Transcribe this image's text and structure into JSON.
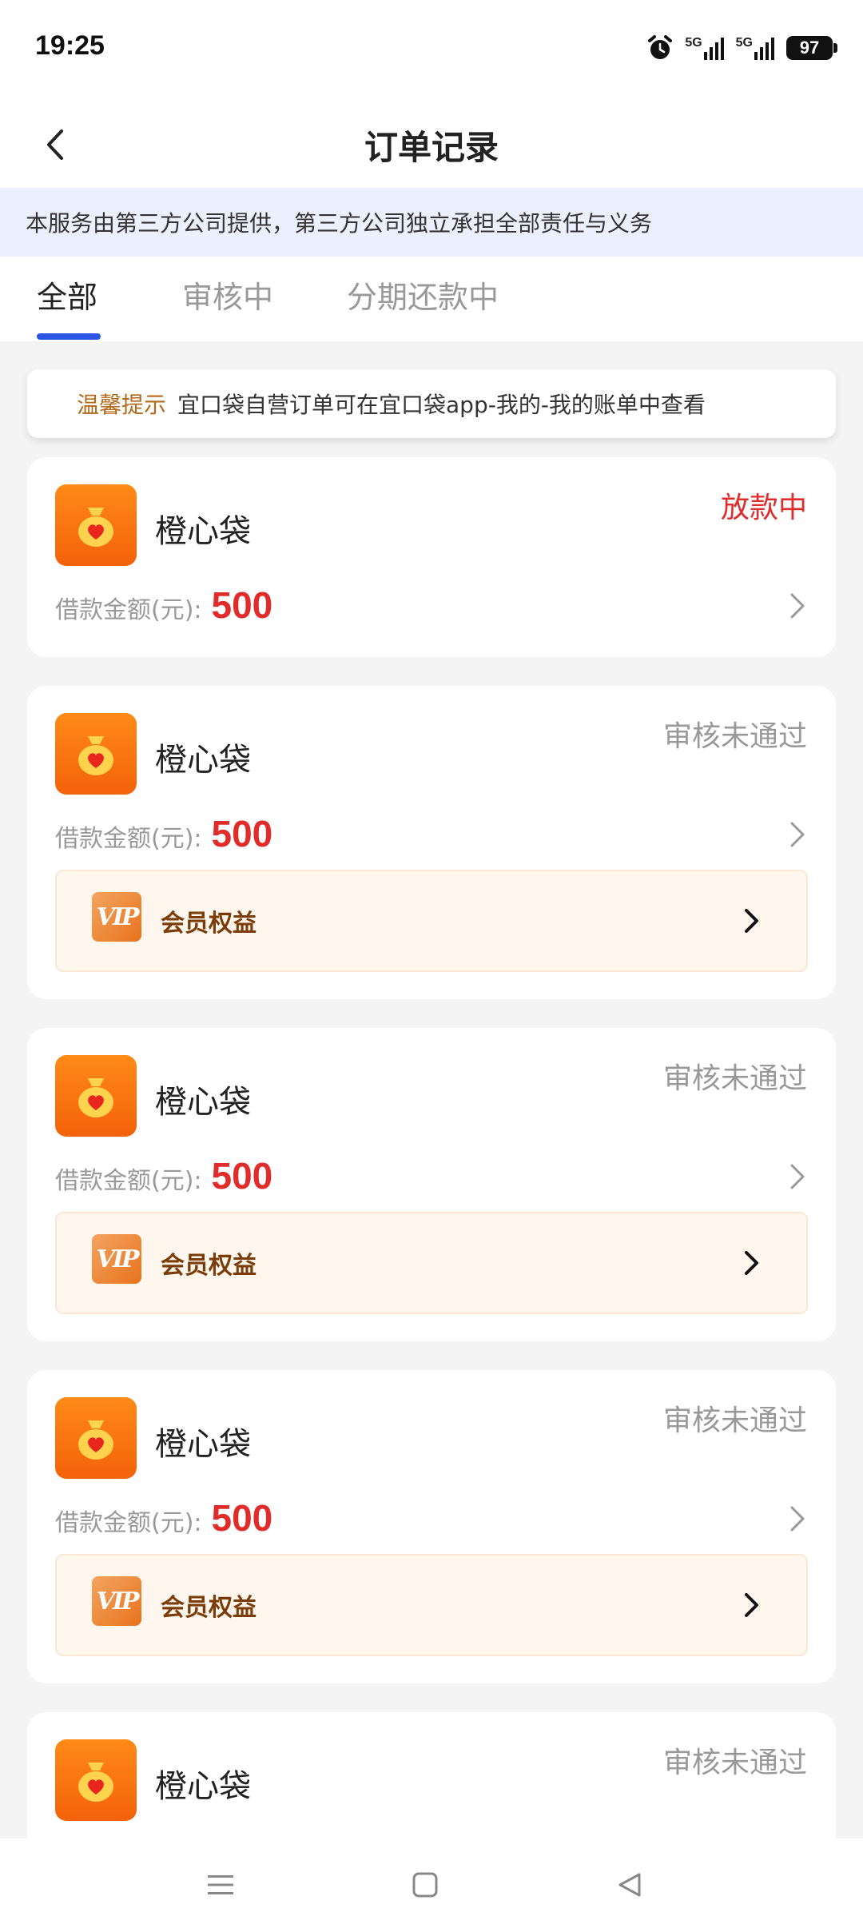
{
  "status_bar": {
    "time": "19:25",
    "battery": "97",
    "network_1": "5G",
    "network_2": "5G"
  },
  "header": {
    "title": "订单记录"
  },
  "notice": {
    "text": "本服务由第三方公司提供，第三方公司独立承担全部责任与义务"
  },
  "tabs": [
    {
      "label": "全部",
      "active": true
    },
    {
      "label": "审核中",
      "active": false
    },
    {
      "label": "分期还款中",
      "active": false
    }
  ],
  "tip": {
    "label": "温馨提示",
    "text": "宜口袋自营订单可在宜口袋app-我的-我的账单中查看"
  },
  "orders": [
    {
      "app_name": "橙心袋",
      "status": "放款中",
      "amount_label": "借款金额(元):",
      "amount": "500",
      "vip_label": ""
    },
    {
      "app_name": "橙心袋",
      "status": "审核未通过",
      "amount_label": "借款金额(元):",
      "amount": "500",
      "vip_label": "会员权益"
    },
    {
      "app_name": "橙心袋",
      "status": "审核未通过",
      "amount_label": "借款金额(元):",
      "amount": "500",
      "vip_label": "会员权益"
    },
    {
      "app_name": "橙心袋",
      "status": "审核未通过",
      "amount_label": "借款金额(元):",
      "amount": "500",
      "vip_label": "会员权益"
    },
    {
      "app_name": "橙心袋",
      "status": "审核未通过",
      "amount_label": "",
      "amount": "",
      "vip_label": ""
    }
  ],
  "vip_icon_text": "VIP",
  "colors": {
    "accent_blue": "#2b55e4",
    "status_red": "#e12c2c",
    "brand_orange": "#f4620b",
    "tip_label": "#b36a1a",
    "vip_text": "#7a3c08"
  },
  "icons": {
    "back": "chevron-left-icon",
    "row": "chevron-right-icon",
    "logo": "money-bag-heart-icon",
    "vip": "vip-badge-icon",
    "nav_menu": "menu-icon",
    "nav_home": "home-square-icon",
    "nav_back": "back-triangle-icon"
  }
}
